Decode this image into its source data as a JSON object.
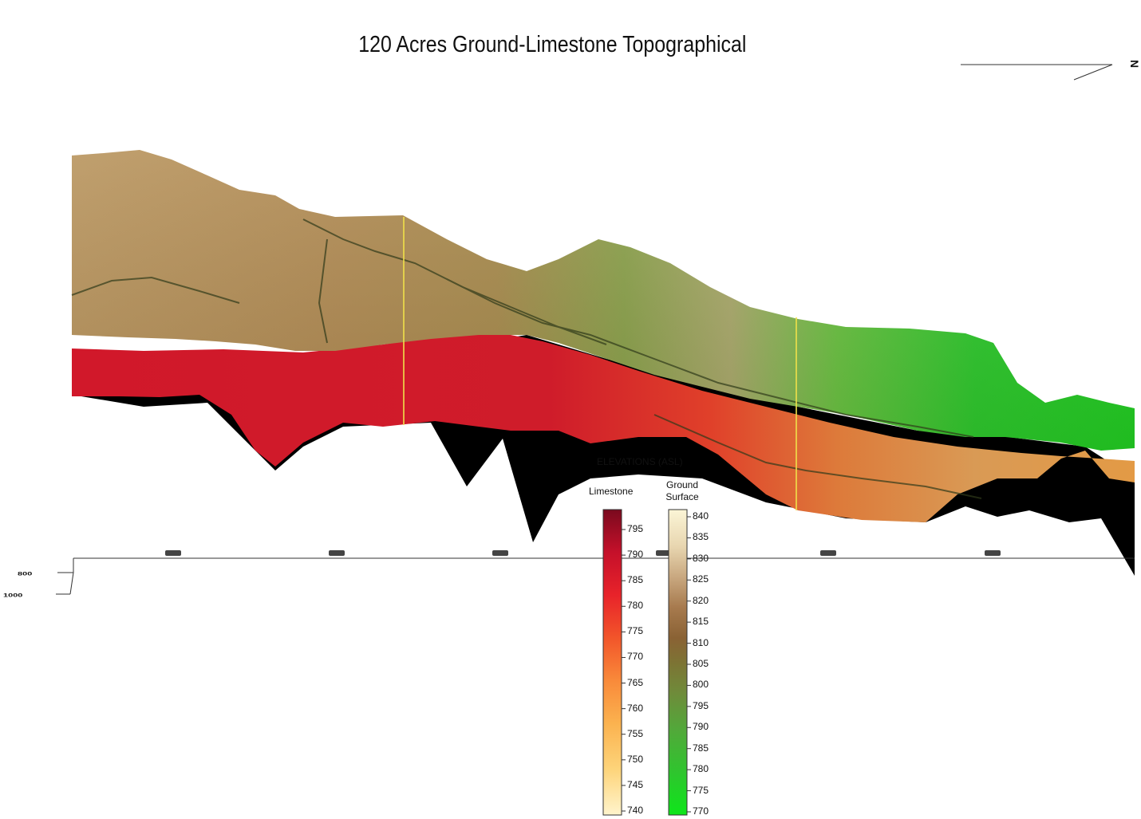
{
  "title": "120 Acres Ground-Limestone Topographical",
  "north_arrow": {
    "label": "N",
    "icon": "north-arrow-icon"
  },
  "axis_labels": [
    "800",
    "1000"
  ],
  "legend": {
    "title": "ELEVATIONS (ASL)",
    "limestone": {
      "label": "Limestone",
      "ticks": [
        "795",
        "790",
        "785",
        "780",
        "775",
        "770",
        "765",
        "760",
        "755",
        "750",
        "745",
        "740"
      ],
      "colors": [
        "#7a0a1e",
        "#c5102a",
        "#e8232a",
        "#f2552a",
        "#f98a3a",
        "#fbb24f",
        "#fdd47a",
        "#fff4cc"
      ]
    },
    "ground": {
      "label_line1": "Ground",
      "label_line2": "Surface",
      "ticks": [
        "840",
        "835",
        "830",
        "825",
        "820",
        "815",
        "810",
        "805",
        "800",
        "795",
        "790",
        "785",
        "780",
        "775",
        "770"
      ],
      "colors": [
        "#fbf5d6",
        "#e8d6b0",
        "#c9a880",
        "#a77a4e",
        "#8a6234",
        "#7d7334",
        "#6f8b3a",
        "#52a83a",
        "#2fc52e",
        "#0ee61a"
      ]
    }
  },
  "colors": {
    "ground_surface_high": "#b8935c",
    "ground_surface_low": "#22c424",
    "limestone_main": "#d4182a",
    "limestone_orange": "#e8702e",
    "shadow": "#000000"
  }
}
